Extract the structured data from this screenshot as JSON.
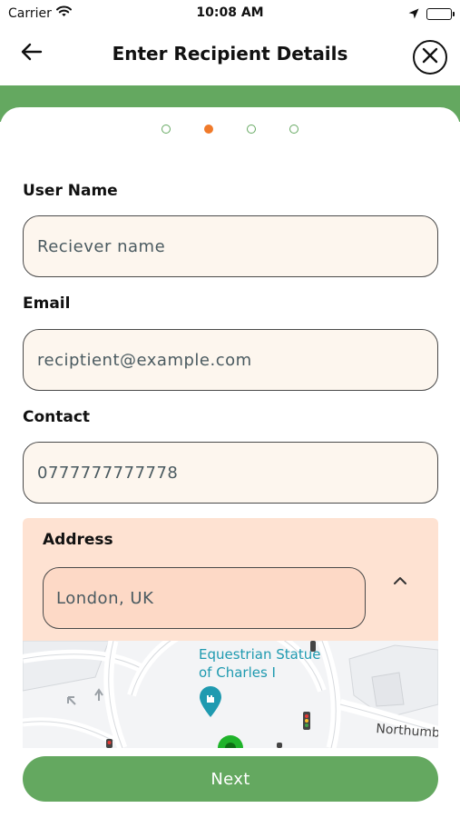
{
  "status_bar": {
    "carrier": "Carrier",
    "time": "10:08 AM"
  },
  "header": {
    "title": "Enter Recipient Details"
  },
  "stepper": {
    "total_steps": 4,
    "current_step": 2
  },
  "form": {
    "user_name": {
      "label": "User Name",
      "value": "Reciever name"
    },
    "email": {
      "label": "Email",
      "value": "reciptient@example.com"
    },
    "contact": {
      "label": "Contact",
      "value": "0777777777778"
    },
    "address": {
      "label": "Address",
      "value": "London, UK"
    }
  },
  "map": {
    "poi_line1": "Equestrian Statue",
    "poi_line2": "of Charles I",
    "street": "Northumb"
  },
  "actions": {
    "next_label": "Next"
  },
  "colors": {
    "brand_green": "#64a860",
    "active_step": "#f07a2a",
    "input_background": "#fdf6ee",
    "address_panel": "#fee2d2",
    "poi_teal": "#1f9ab0"
  },
  "icons": {
    "back": "arrow-left-icon",
    "close": "close-icon",
    "collapse": "chevron-up-icon",
    "poi": "monument-pin-icon"
  }
}
